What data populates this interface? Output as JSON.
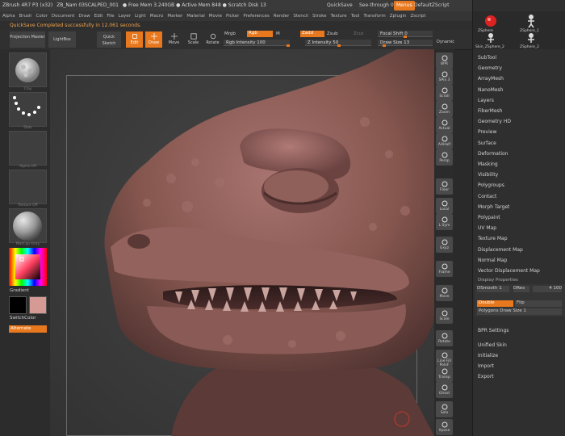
{
  "titlebar": {
    "app": "ZBrush 4R7 P3 (x32)",
    "doc": "ZB_Nam 03SCALPED_001",
    "mem": "● Free Mem 3.240GB ● Active Mem 848 ● Scratch Disk 13",
    "quicksave": "QuickSave",
    "seethrough": "See-through  0",
    "menus": "Menus",
    "script": "DefaultZScript"
  },
  "menubar": [
    "Alpha",
    "Brush",
    "Color",
    "Document",
    "Draw",
    "Edit",
    "File",
    "Layer",
    "Light",
    "Macro",
    "Marker",
    "Material",
    "Movie",
    "Picker",
    "Preferences",
    "Render",
    "Stencil",
    "Stroke",
    "Texture",
    "Tool",
    "Transform",
    "Zplugin",
    "Zscript"
  ],
  "notice": "QuickSave Completed successfully in 12.061 seconds.",
  "toolbar": {
    "projection_master": "Projection Master",
    "lightbox": "LightBox",
    "quick_sketch": "Quick Sketch",
    "edit": "Edit",
    "draw": "Draw",
    "move": "Move",
    "scale": "Scale",
    "rotate": "Rotate",
    "mrgb": "Mrgb",
    "rgb": "Rgb",
    "m": "M",
    "zadd": "Zadd",
    "zsub": "Zsub",
    "zcut": "Zcut",
    "rgb_intensity": "Rgb Intensity 100",
    "z_intensity": "Z Intensity 50",
    "focal_shift": "Focal Shift 0",
    "draw_size": "Draw Size 13",
    "dynamic": "Dynamic"
  },
  "left": {
    "thumbs": [
      {
        "name": "brush",
        "label": "Clay"
      },
      {
        "name": "stroke",
        "label": "Dots"
      },
      {
        "name": "alpha",
        "label": "Alpha Off"
      },
      {
        "name": "texture",
        "label": "Texture Off"
      },
      {
        "name": "material",
        "label": "MatCap Gray"
      }
    ],
    "gradient": "Gradient",
    "switch_color": "SwitchColor",
    "alternate": "Alternate",
    "main_color": "#000000",
    "secondary_color": "#d69a94"
  },
  "rightcol": [
    "BPR",
    "SPix 3",
    "Scroll",
    "Zoom",
    "Actual",
    "AAHalf",
    "Persp",
    "Floor",
    "Local",
    "L.Sym",
    "Gxyz",
    "Frame",
    "Move",
    "Scale",
    "Rotate",
    "Line Fill PolyF",
    "Transp",
    "Ghost",
    "Solo",
    "Xpose"
  ],
  "rightpanel": {
    "subtools": [
      "ZSphere",
      "ZSphere_1",
      "Skin_ZSphere_2",
      "ZSphere_2"
    ],
    "items": [
      "SubTool",
      "Geometry",
      "ArrayMesh",
      "NanoMesh",
      "Layers",
      "FiberMesh",
      "Geometry HD",
      "Preview",
      "Surface",
      "Deformation",
      "Masking",
      "Visibility",
      "Polygroups",
      "Contact",
      "Morph Target",
      "Polypaint",
      "UV Map",
      "Texture Map",
      "Displacement Map",
      "Normal Map",
      "Vector Displacement Map",
      "Display Properties"
    ],
    "dsmooth": "DSmooth 1",
    "dres": "DRes",
    "bpr_value": "4 100",
    "double": "Double",
    "flip": "Flip",
    "polys_draw_size": "Polygons Draw Size 1",
    "bpr_settings": "BPR Settings",
    "bottom": [
      "Unified Skin",
      "Initialize",
      "Import",
      "Export"
    ]
  },
  "colors": {
    "accent": "#e8781e",
    "skin": "#8d5d5a",
    "bg": "#2f2f2f"
  }
}
